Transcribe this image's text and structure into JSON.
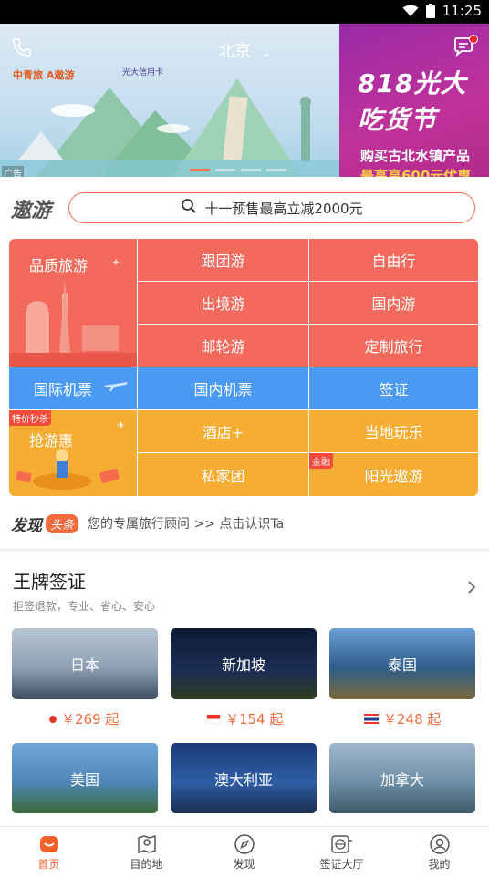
{
  "status_bar": {
    "time": "11:25"
  },
  "header": {
    "city": "北京",
    "ad_label": "广告",
    "logos": {
      "left": "中青旅 A遨游",
      "right": "光大信用卡"
    }
  },
  "banner": {
    "promo_title": "818光大吃货节",
    "promo_line1": "购买古北水镇产品",
    "promo_line2": "最高享600元优惠"
  },
  "search": {
    "brand": "遨游",
    "placeholder": "十一预售最高立减2000元"
  },
  "grid": {
    "quality_travel": "品质旅游",
    "tour_group": "跟团游",
    "free_travel": "自由行",
    "outbound": "出境游",
    "domestic": "国内游",
    "cruise": "邮轮游",
    "custom": "定制旅行",
    "intl_flight": "国际机票",
    "domestic_flight": "国内机票",
    "visa": "签证",
    "flash_badge": "特价秒杀",
    "deals": "抢游惠",
    "hotel": "酒店+",
    "local_fun": "当地玩乐",
    "private_group": "私家团",
    "finance_badge": "金融",
    "sunshine": "阳光遨游"
  },
  "discover": {
    "label": "发现",
    "tag": "头条",
    "text": "您的专属旅行顾问 >> 点击认识Ta"
  },
  "visa_section": {
    "title": "王牌签证",
    "subtitle": "拒签退款，专业、省心、安心",
    "cards": [
      {
        "name": "日本",
        "price": "￥269 起"
      },
      {
        "name": "新加坡",
        "price": "￥154 起"
      },
      {
        "name": "泰国",
        "price": "￥248 起"
      },
      {
        "name": "美国"
      },
      {
        "name": "澳大利亚"
      },
      {
        "name": "加拿大"
      }
    ]
  },
  "tabbar": {
    "tabs": [
      "首页",
      "目的地",
      "发现",
      "签证大厅",
      "我的"
    ],
    "active": "首页"
  },
  "colors": {
    "accent": "#f5602a",
    "grid_red": "#f36a5c",
    "grid_blue": "#4a99f2",
    "grid_orange": "#f5ad33"
  }
}
